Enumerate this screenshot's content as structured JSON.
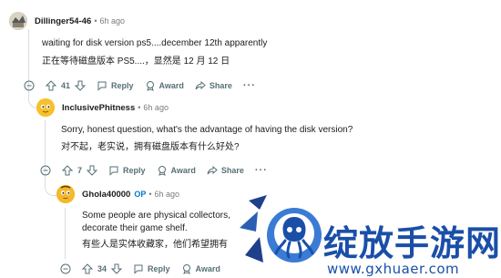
{
  "comments": [
    {
      "username": "Dillinger54-46",
      "time": "6h ago",
      "line1": "waiting for disk version ps5....december 12th apparently",
      "line2": "正在等待磁盘版本 PS5....，显然是 12 月 12 日",
      "votes": "41",
      "reply": "Reply",
      "award": "Award",
      "share": "Share",
      "more": "···"
    },
    {
      "username": "InclusivePhitness",
      "time": "6h ago",
      "line1": "Sorry, honest question, what's the advantage of having the disk version?",
      "line2": "对不起，老实说，拥有磁盘版本有什么好处?",
      "votes": "7",
      "reply": "Reply",
      "award": "Award",
      "share": "Share",
      "more": "···"
    },
    {
      "username": "Ghola40000",
      "op": "OP",
      "time": "6h ago",
      "line1": "Some people are physical collectors,",
      "line2": "decorate their game shelf.",
      "line3": "有些人是实体收藏家，他们希望拥有",
      "votes": "34",
      "reply": "Reply",
      "award": "Award"
    }
  ],
  "watermark": {
    "title": "绽放手游网",
    "url": "www.gxhuaer.com"
  },
  "colors": {
    "muted": "#576f76",
    "op": "#0079d3",
    "watermark_blue": "#1a4fa8"
  }
}
